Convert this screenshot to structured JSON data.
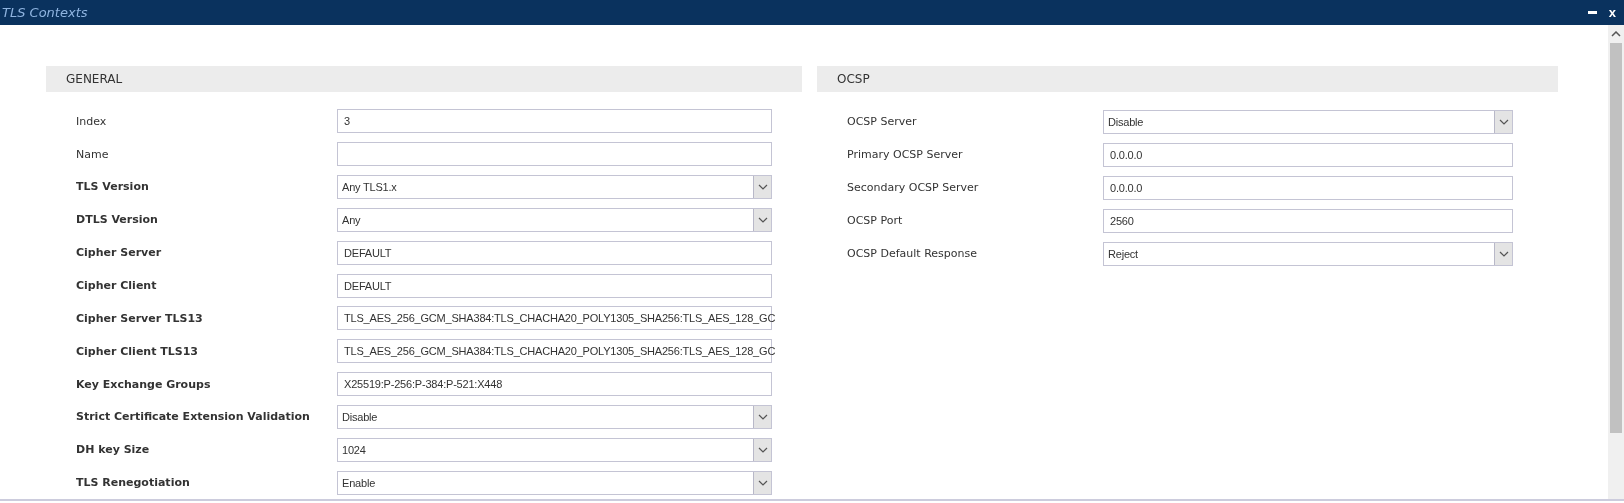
{
  "window": {
    "title": "TLS Contexts",
    "close": "x"
  },
  "sections": [
    {
      "title": "GENERAL",
      "fields": [
        {
          "label": "Index",
          "bold": false,
          "kind": "text",
          "value": "3"
        },
        {
          "label": "Name",
          "bold": false,
          "kind": "text"
        },
        {
          "label": "TLS Version",
          "bold": true,
          "kind": "select",
          "value": "Any TLS1.x"
        },
        {
          "label": "DTLS Version",
          "bold": true,
          "kind": "select",
          "value": "Any"
        },
        {
          "label": "Cipher Server",
          "bold": true,
          "kind": "text",
          "value": "DEFAULT"
        },
        {
          "label": "Cipher Client",
          "bold": true,
          "kind": "text",
          "value": "DEFAULT"
        },
        {
          "label": "Cipher Server TLS13",
          "bold": true,
          "kind": "text",
          "value": "TLS_AES_256_GCM_SHA384:TLS_CHACHA20_POLY1305_SHA256:TLS_AES_128_GC"
        },
        {
          "label": "Cipher Client TLS13",
          "bold": true,
          "kind": "text",
          "value": "TLS_AES_256_GCM_SHA384:TLS_CHACHA20_POLY1305_SHA256:TLS_AES_128_GC"
        },
        {
          "label": "Key Exchange Groups",
          "bold": true,
          "kind": "text",
          "value": "X25519:P-256:P-384:P-521:X448"
        },
        {
          "label": "Strict Certificate Extension Validation",
          "bold": true,
          "kind": "select",
          "value": "Disable"
        },
        {
          "label": "DH key Size",
          "bold": true,
          "kind": "select",
          "value": "1024"
        },
        {
          "label": "TLS Renegotiation",
          "bold": true,
          "kind": "select",
          "value": "Enable"
        }
      ]
    },
    {
      "title": "OCSP",
      "fields": [
        {
          "label": "OCSP Server",
          "bold": false,
          "kind": "select",
          "value": "Disable"
        },
        {
          "label": "Primary OCSP Server",
          "bold": false,
          "kind": "text",
          "value": "0.0.0.0"
        },
        {
          "label": "Secondary OCSP Server",
          "bold": false,
          "kind": "text",
          "value": "0.0.0.0"
        },
        {
          "label": "OCSP Port",
          "bold": false,
          "kind": "text",
          "value": "2560"
        },
        {
          "label": "OCSP Default Response",
          "bold": false,
          "kind": "select",
          "value": "Reject"
        }
      ]
    }
  ]
}
